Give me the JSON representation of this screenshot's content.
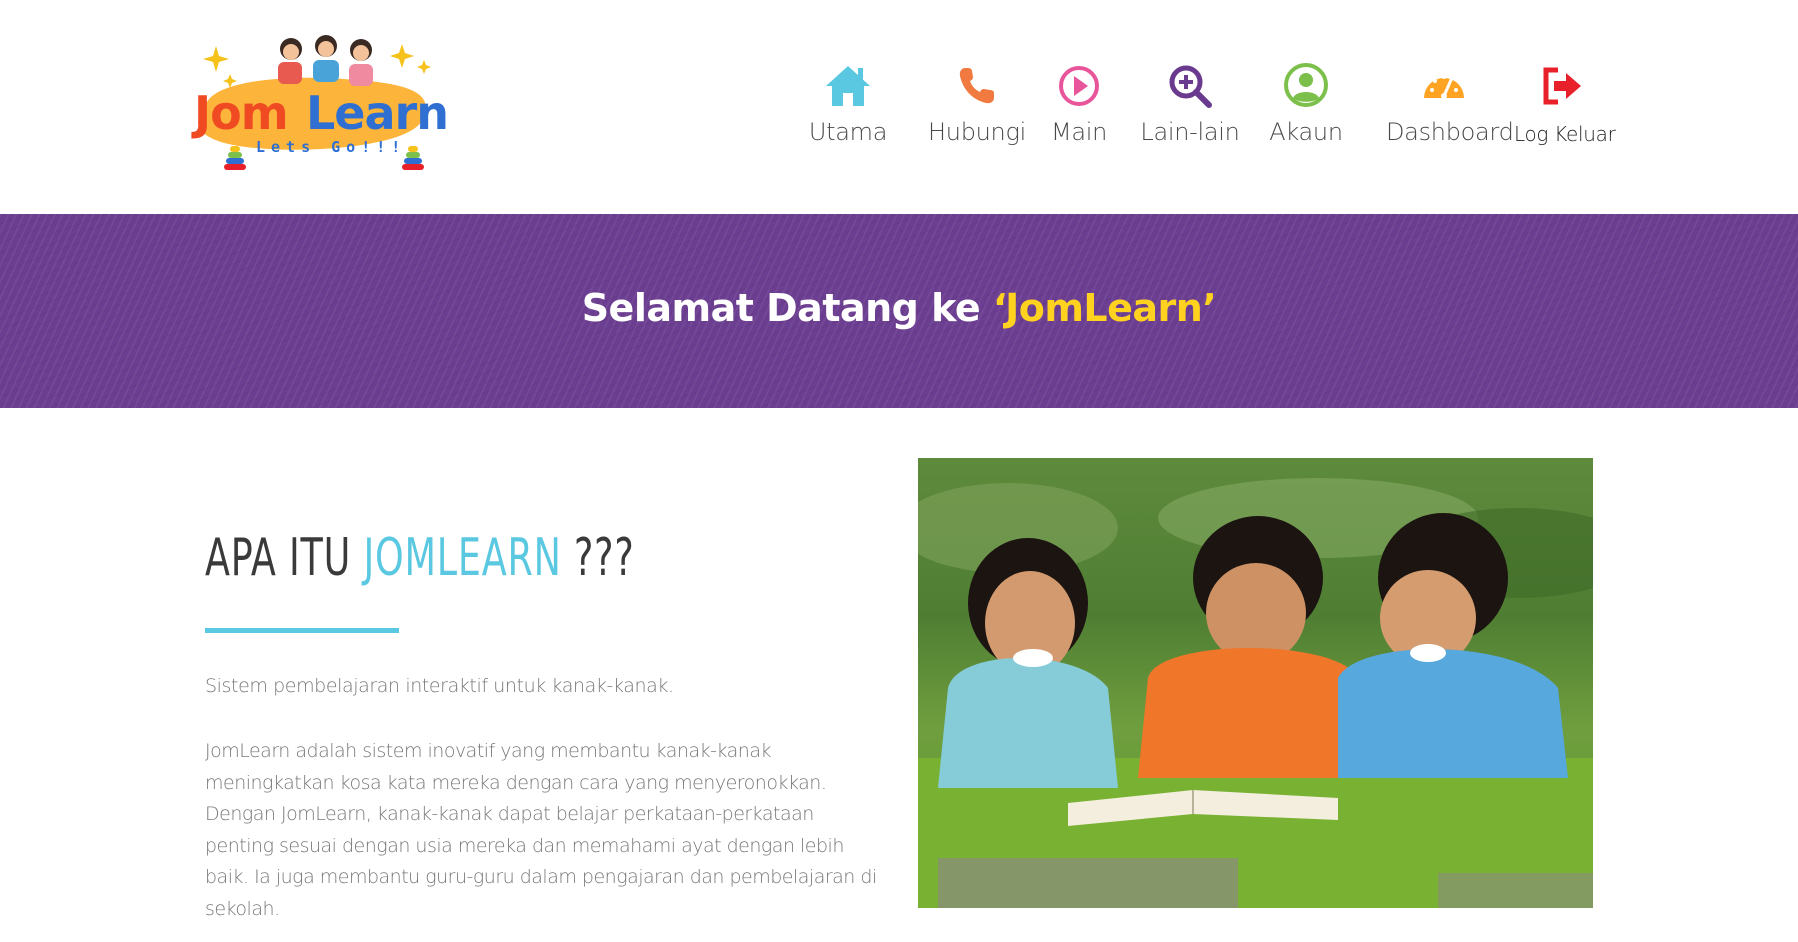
{
  "logo": {
    "main_text": "JomLearn",
    "tagline": "Lets Go!!!"
  },
  "nav": {
    "items": [
      {
        "label": "Utama",
        "icon": "home-icon",
        "color": "#5bc8e2"
      },
      {
        "label": "Hubungi",
        "icon": "phone-icon",
        "color": "#f07a3f"
      },
      {
        "label": "Main",
        "icon": "play-icon",
        "color": "#e8559a"
      },
      {
        "label": "Lain-lain",
        "icon": "zoom-in-icon",
        "color": "#6a3a8f"
      },
      {
        "label": "Akaun",
        "icon": "user-icon",
        "color": "#7cc04b"
      },
      {
        "label": "Dashboard",
        "icon": "dashboard-icon",
        "color": "#ffa322"
      },
      {
        "label": "Log Keluar",
        "icon": "logout-icon",
        "color": "#e8202a"
      }
    ]
  },
  "banner": {
    "prefix": "Selamat Datang ke ",
    "highlight": "‘JomLearn’"
  },
  "about": {
    "heading_prefix": "APA ITU ",
    "heading_brand": "JOMLEARN",
    "heading_suffix": " ???",
    "intro": "Sistem pembelajaran interaktif untuk kanak-kanak.",
    "description": "JomLearn adalah sistem inovatif yang membantu kanak-kanak meningkatkan kosa kata mereka dengan cara yang menyeronokkan. Dengan JomLearn, kanak-kanak dapat belajar perkataan-perkataan penting sesuai dengan usia mereka dan memahami ayat dengan lebih baik. Ia juga membantu guru-guru dalam pengajaran dan pembelajaran di sekolah."
  },
  "colors": {
    "accent": "#5bc8e2",
    "banner": "#6c3e91",
    "highlight": "#ffd21f"
  }
}
